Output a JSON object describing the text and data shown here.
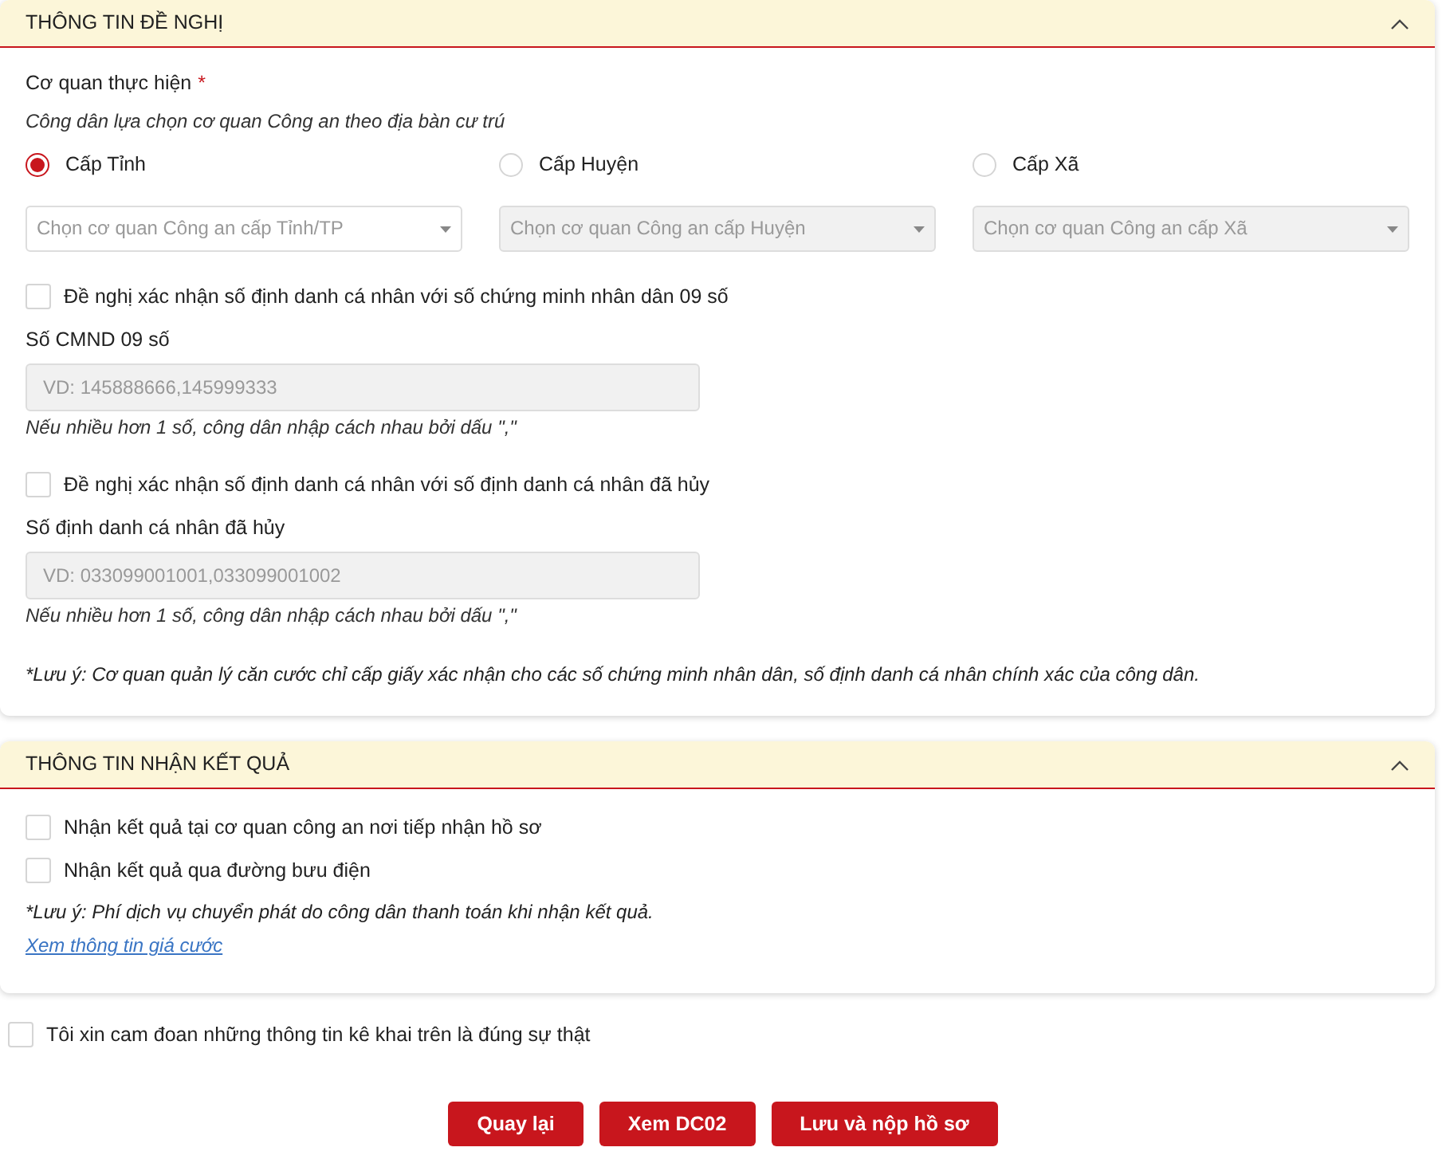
{
  "request_section": {
    "title": "THÔNG TIN ĐỀ NGHỊ",
    "expanded": true,
    "agency_label": "Cơ quan thực hiện",
    "required_mark": "*",
    "agency_hint": "Công dân lựa chọn cơ quan Công an theo địa bàn cư trú",
    "levels": [
      {
        "label": "Cấp Tỉnh",
        "selected": true
      },
      {
        "label": "Cấp Huyện",
        "selected": false
      },
      {
        "label": "Cấp Xã",
        "selected": false
      }
    ],
    "selects": [
      {
        "placeholder": "Chọn cơ quan Công an cấp Tỉnh/TP",
        "disabled": false
      },
      {
        "placeholder": "Chọn cơ quan Công an cấp Huyện",
        "disabled": true
      },
      {
        "placeholder": "Chọn cơ quan Công an cấp Xã",
        "disabled": true
      }
    ],
    "groups": [
      {
        "checkbox": {
          "label": "Đề nghị xác nhận số định danh cá nhân với số chứng minh nhân dân 09 số",
          "checked": false
        },
        "field_label": "Số CMND 09 số",
        "placeholder": "VD: 145888666,145999333",
        "disabled": true,
        "hint": "Nếu nhiều hơn 1 số, công dân nhập cách nhau bởi dấu \",\""
      },
      {
        "checkbox": {
          "label": "Đề nghị xác nhận số định danh cá nhân với số định danh cá nhân đã hủy",
          "checked": false
        },
        "field_label": "Số định danh cá nhân đã hủy",
        "placeholder": "VD: 033099001001,033099001002",
        "disabled": true,
        "hint": "Nếu nhiều hơn 1 số, công dân nhập cách nhau bởi dấu \",\""
      }
    ],
    "note": "*Lưu ý: Cơ quan quản lý căn cước chỉ cấp giấy xác nhận cho các số chứng minh nhân dân, số định danh cá nhân chính xác của công dân."
  },
  "result_section": {
    "title": "THÔNG TIN NHẬN KẾT QUẢ",
    "expanded": true,
    "options": [
      {
        "label": "Nhận kết quả tại cơ quan công an nơi tiếp nhận hồ sơ",
        "checked": false
      },
      {
        "label": "Nhận kết quả qua đường bưu điện",
        "checked": false
      }
    ],
    "note": "*Lưu ý: Phí dịch vụ chuyển phát do công dân thanh toán khi nhận kết quả.",
    "link": "Xem thông tin giá cước"
  },
  "pledge": {
    "label": "Tôi xin cam đoan những thông tin kê khai trên là đúng sự thật",
    "checked": false
  },
  "buttons": [
    "Quay lại",
    "Xem DC02",
    "Lưu và nộp hồ sơ"
  ]
}
